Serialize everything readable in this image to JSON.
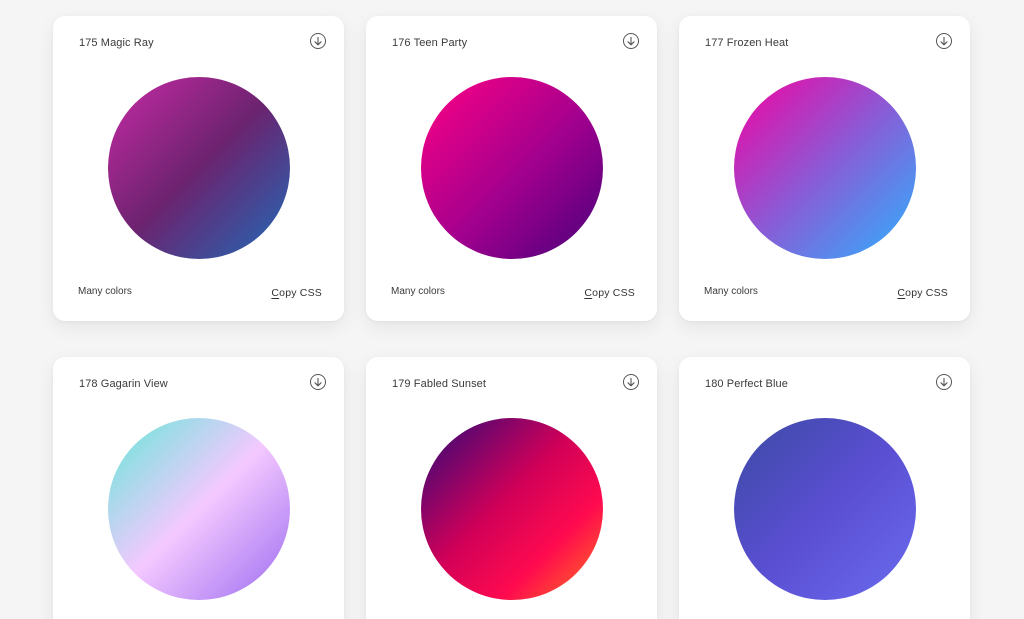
{
  "gradients": [
    {
      "title": "175 Magic Ray",
      "description": "Many colors",
      "copy_label": "Copy CSS",
      "colors": [
        "#c92aa6",
        "#6b236f",
        "#1f6bb8"
      ],
      "angle": "135deg",
      "stops": [
        "0%",
        "50%",
        "100%"
      ]
    },
    {
      "title": "176 Teen Party",
      "description": "Many colors",
      "copy_label": "Copy CSS",
      "colors": [
        "#ff0084",
        "#a1008e",
        "#47007a"
      ],
      "angle": "135deg",
      "stops": [
        "0%",
        "55%",
        "100%"
      ]
    },
    {
      "title": "177 Frozen Heat",
      "description": "Many colors",
      "copy_label": "Copy CSS",
      "colors": [
        "#f500a0",
        "#8a5bd6",
        "#2cb2ff"
      ],
      "angle": "135deg",
      "stops": [
        "0%",
        "50%",
        "100%"
      ]
    },
    {
      "title": "178 Gagarin View",
      "description": "",
      "copy_label": "",
      "colors": [
        "#64e8d8",
        "#f4c8ff",
        "#9b6bf0"
      ],
      "angle": "135deg",
      "stops": [
        "0%",
        "50%",
        "100%"
      ]
    },
    {
      "title": "179 Fabled Sunset",
      "description": "",
      "copy_label": "",
      "colors": [
        "#2a0a7a",
        "#d00058",
        "#ff0a4f",
        "#ff7a1a"
      ],
      "angle": "135deg",
      "stops": [
        "0%",
        "45%",
        "72%",
        "100%"
      ]
    },
    {
      "title": "180 Perfect Blue",
      "description": "",
      "copy_label": "",
      "colors": [
        "#3c4ba3",
        "#5a4ed2",
        "#6b6bef"
      ],
      "angle": "135deg",
      "stops": [
        "0%",
        "50%",
        "100%"
      ]
    }
  ],
  "icons": {
    "download": "download-icon"
  }
}
